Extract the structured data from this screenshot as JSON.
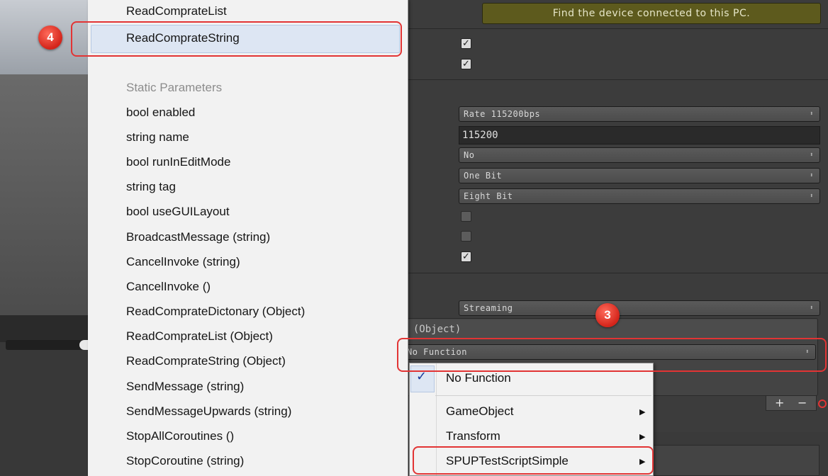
{
  "inspector": {
    "find_device_button": "Find the device connected to this PC.",
    "baud_rate_select": "Rate 115200bps",
    "baud_rate_value": "115200",
    "parity_select": "No",
    "stop_bits_select": "One Bit",
    "data_bits_select": "Eight Bit",
    "read_mode_select": "Streaming",
    "event_header": "t (Object)",
    "function_select": "No Function",
    "add_button": "+",
    "remove_button": "−"
  },
  "method_menu": {
    "items_top": [
      "ReadComprateList",
      "ReadComprateString"
    ],
    "static_header": "Static Parameters",
    "static_items": [
      "bool enabled",
      "string name",
      "bool runInEditMode",
      "string tag",
      "bool useGUILayout",
      "BroadcastMessage (string)",
      "CancelInvoke (string)",
      "CancelInvoke ()",
      "ReadComprateDictonary (Object)",
      "ReadComprateList (Object)",
      "ReadComprateString (Object)",
      "SendMessage (string)",
      "SendMessageUpwards (string)",
      "StopAllCoroutines ()",
      "StopCoroutine (string)"
    ]
  },
  "function_menu": {
    "items": [
      "No Function",
      "GameObject",
      "Transform",
      "SPUPTestScriptSimple"
    ],
    "check_glyph": "✓",
    "arrow_glyph": "▶"
  },
  "annotations": {
    "badge_step4": "4",
    "badge_step3": "3",
    "color": "#e23434"
  }
}
